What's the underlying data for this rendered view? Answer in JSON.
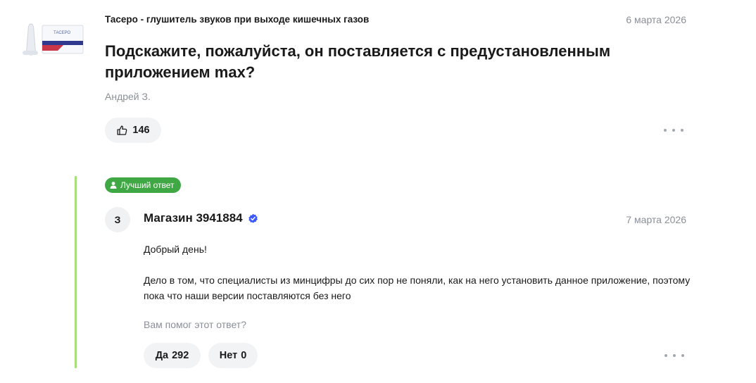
{
  "question": {
    "product_name": "Тасеро - глушитель звуков при выходе кишечных газов",
    "product_thumb_text": "ТАСЕРО",
    "date": "6 марта 2026",
    "text": "Подскажите, пожалуйста, он поставляется с предустановленным приложением max?",
    "author": "Андрей З.",
    "likes": "146",
    "like_icon": "thumbs-up-icon",
    "more_icon": "more-dots-icon"
  },
  "answer": {
    "badge_label": "Лучший ответ",
    "badge_icon": "person-icon",
    "avatar_letter": "З",
    "shop_name": "Магазин 3941884",
    "verified_icon": "verified-check-icon",
    "date": "7 марта 2026",
    "greeting": "Добрый день!",
    "body": "Дело в том, что специалисты из минцифры до сих пор не поняли, как на него установить данное приложение, поэтому пока что наши версии поставляются без него",
    "helpful_question": "Вам помог этот ответ?",
    "yes_label": "Да",
    "yes_count": "292",
    "no_label": "Нет",
    "no_count": "0"
  },
  "colors": {
    "accent_green": "#3fa844",
    "bar_green": "#a6e07a",
    "verified_blue": "#3d5afe",
    "muted": "#8a8f98"
  }
}
